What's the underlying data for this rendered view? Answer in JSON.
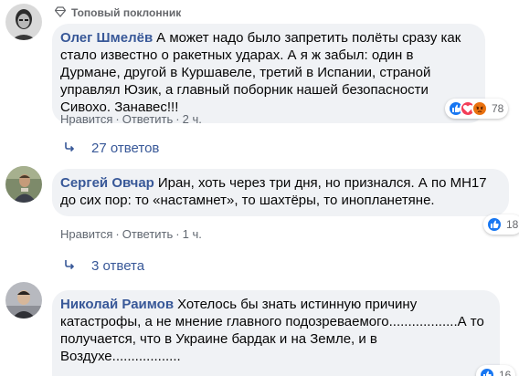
{
  "badge": {
    "icon": "diamond-icon",
    "label": "Топовый поклонник"
  },
  "comments": [
    {
      "author": "Олег Шмелёв",
      "text": "А может надо было запретить полёты сразу как стало известно о ракетных ударах. А я ж забыл: один в Дурмане, другой в Куршавеле, третий в Испании, страной управлял Юзик, а главный поборник нашей безопасности Сивохо. Занавес!!!",
      "like": "Нравится",
      "reply": "Ответить",
      "time": "2 ч.",
      "reaction_count": "78",
      "reactions": [
        "like-icon",
        "love-icon",
        "angry-icon"
      ],
      "replies_label": "27 ответов"
    },
    {
      "author": "Сергей Овчар",
      "text": "Иран, хоть через три дня, но признался. А по МН17 до сих пор: то «настамнет», то шахтёры, то инопланетяне.",
      "like": "Нравится",
      "reply": "Ответить",
      "time": "1 ч.",
      "reaction_count": "18",
      "reactions": [
        "like-icon"
      ],
      "replies_label": "3 ответа"
    },
    {
      "author": "Николай Раимов",
      "text": "Хотелось бы знать истинную причину катастрофы, а не мнение главного подозреваемого..................А то получается, что в Украине бардак и на Земле, и в Воздухе..................",
      "reaction_count": "16",
      "reactions": [
        "like-icon"
      ]
    }
  ],
  "colors": {
    "bubble_bg": "#f0f2f5",
    "author": "#385898",
    "meta": "#606770",
    "like_blue": "#1877f2",
    "love_red": "#f33e58",
    "angry_orange": "#e9710f"
  }
}
